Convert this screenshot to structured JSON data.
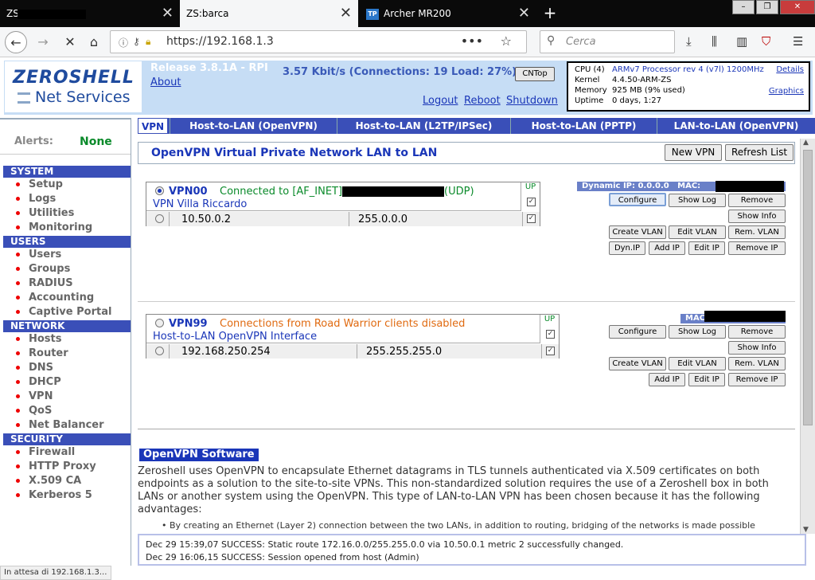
{
  "browser": {
    "tabs": [
      {
        "title": "ZS"
      },
      {
        "title": "ZS:barca"
      },
      {
        "title": "Archer MR200",
        "icon_text": "TP"
      }
    ],
    "url": "https://192.168.1.3",
    "search_placeholder": "Cerca",
    "status": "In attesa di 192.168.1.3..."
  },
  "header": {
    "logo_top": "ZEROSHELL",
    "logo_bottom": "Net Services",
    "release": "Release 3.8.1A - RPI",
    "about": "About",
    "throughput": "3.57 Kbit/s (Connections: 19 Load: 27%)",
    "cntop": "CNTop",
    "logout": "Logout",
    "reboot": "Reboot",
    "shutdown": "Shutdown",
    "sysinfo": {
      "cpu_label": "CPU (4)",
      "cpu_value": "ARMv7 Processor rev 4 (v7l) 1200MHz",
      "kernel_label": "Kernel",
      "kernel_value": "4.4.50-ARM-ZS",
      "memory_label": "Memory",
      "memory_value": "925 MB  (9% used)",
      "uptime_label": "Uptime",
      "uptime_value": "0 days, 1:27",
      "details": "Details",
      "graphics": "Graphics"
    }
  },
  "sidebar": {
    "alerts_label": "Alerts:",
    "alerts_value": "None",
    "sections": [
      {
        "title": "SYSTEM",
        "items": [
          "Setup",
          "Logs",
          "Utilities",
          "Monitoring"
        ]
      },
      {
        "title": "USERS",
        "items": [
          "Users",
          "Groups",
          "RADIUS",
          "Accounting",
          "Captive Portal"
        ]
      },
      {
        "title": "NETWORK",
        "items": [
          "Hosts",
          "Router",
          "DNS",
          "DHCP",
          "VPN",
          "QoS",
          "Net Balancer"
        ]
      },
      {
        "title": "SECURITY",
        "items": [
          "Firewall",
          "HTTP Proxy",
          "X.509 CA",
          "Kerberos 5"
        ]
      }
    ]
  },
  "tabs": [
    "VPN",
    "Host-to-LAN (OpenVPN)",
    "Host-to-LAN (L2TP/IPSec)",
    "Host-to-LAN (PPTP)",
    "LAN-to-LAN (OpenVPN)"
  ],
  "content": {
    "title": "OpenVPN Virtual Private Network LAN to LAN",
    "new_vpn": "New VPN",
    "refresh_list": "Refresh List",
    "vpn00": {
      "name": "VPN00",
      "status_prefix": "Connected to [AF_INET]",
      "status_suffix": "(UDP)",
      "description": "VPN Villa Riccardo",
      "up": "UP",
      "ip": "10.50.0.2",
      "mask": "255.0.0.0",
      "dynamic_ip": "Dynamic IP: 0.0.0.0",
      "mac_label": "MAC:",
      "status_color": "#0a8a2a"
    },
    "vpn99": {
      "name": "VPN99",
      "status": "Connections from Road Warrior clients disabled",
      "description": "Host-to-LAN OpenVPN Interface",
      "up": "UP",
      "ip": "192.168.250.254",
      "mask": "255.255.255.0",
      "mac_label": "MAC",
      "status_color": "#e06a10"
    },
    "buttons": {
      "configure": "Configure",
      "show_log": "Show Log",
      "remove": "Remove",
      "show_info": "Show Info",
      "create_vlan": "Create VLAN",
      "edit_vlan": "Edit VLAN",
      "rem_vlan": "Rem. VLAN",
      "dyn_ip": "Dyn.IP",
      "add_ip": "Add IP",
      "edit_ip": "Edit IP",
      "remove_ip": "Remove IP"
    },
    "software_title": "OpenVPN Software",
    "software_text": "Zeroshell uses OpenVPN to encapsulate Ethernet datagrams in TLS tunnels authenticated via X.509 certificates on both endpoints as a solution to the site-to-site VPNs. This non-standardized solution requires the use of a Zeroshell box in both LANs or another system using the OpenVPN. This type of LAN-to-LAN VPN has been chosen because it has the following advantages:",
    "bullet": "• By creating an Ethernet (Layer 2) connection between the two LANs, in addition to routing, bridging of the networks is made possible"
  },
  "log": [
    "Dec 29 15:39,07 SUCCESS: Static route 172.16.0.0/255.255.0.0 via 10.50.0.1 metric 2 successfully changed.",
    "Dec 29 16:06,15 SUCCESS: Session opened from host  (Admin)"
  ],
  "icons": [
    "close-icon",
    "plus-icon",
    "back-arrow-icon",
    "forward-arrow-icon",
    "stop-icon",
    "home-icon",
    "info-icon",
    "key-icon",
    "lock-icon",
    "more-dots-icon",
    "star-icon",
    "search-icon",
    "download-icon",
    "library-icon",
    "sidebar-icon",
    "ublock-icon",
    "menu-icon"
  ]
}
